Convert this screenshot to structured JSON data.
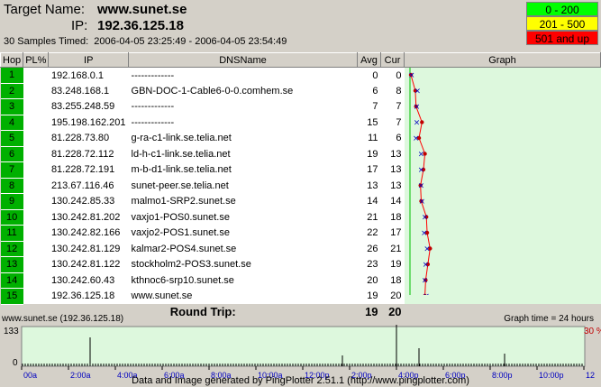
{
  "header": {
    "target_label": "Target Name:",
    "target_value": "www.sunet.se",
    "ip_label": "IP:",
    "ip_value": "192.36.125.18",
    "samples_text": "30 Samples Timed:",
    "samples_range": "2006-04-05 23:25:49 - 2006-04-05 23:54:49"
  },
  "legend": [
    {
      "label": "0 - 200",
      "color": "#00ff00"
    },
    {
      "label": "201 - 500",
      "color": "#ffff00"
    },
    {
      "label": "501 and up",
      "color": "#ff0000"
    }
  ],
  "columns": {
    "hop": "Hop",
    "pl": "PL%",
    "ip": "IP",
    "dns": "DNSName",
    "avg": "Avg",
    "cur": "Cur",
    "graph": "Graph"
  },
  "graph_scale": {
    "min": "0",
    "max": "230"
  },
  "hops": [
    {
      "hop": "1",
      "ip": "192.168.0.1",
      "dns": "-------------",
      "avg": "0",
      "cur": "0"
    },
    {
      "hop": "2",
      "ip": "83.248.168.1",
      "dns": "GBN-DOC-1-Cable6-0-0.comhem.se",
      "avg": "6",
      "cur": "8"
    },
    {
      "hop": "3",
      "ip": "83.255.248.59",
      "dns": "-------------",
      "avg": "7",
      "cur": "7"
    },
    {
      "hop": "4",
      "ip": "195.198.162.201",
      "dns": "-------------",
      "avg": "15",
      "cur": "7"
    },
    {
      "hop": "5",
      "ip": "81.228.73.80",
      "dns": "g-ra-c1-link.se.telia.net",
      "avg": "11",
      "cur": "6"
    },
    {
      "hop": "6",
      "ip": "81.228.72.112",
      "dns": "ld-h-c1-link.se.telia.net",
      "avg": "19",
      "cur": "13"
    },
    {
      "hop": "7",
      "ip": "81.228.72.191",
      "dns": "m-b-d1-link.se.telia.net",
      "avg": "17",
      "cur": "13"
    },
    {
      "hop": "8",
      "ip": "213.67.116.46",
      "dns": "sunet-peer.se.telia.net",
      "avg": "13",
      "cur": "13"
    },
    {
      "hop": "9",
      "ip": "130.242.85.33",
      "dns": "malmo1-SRP2.sunet.se",
      "avg": "14",
      "cur": "14"
    },
    {
      "hop": "10",
      "ip": "130.242.81.202",
      "dns": "vaxjo1-POS0.sunet.se",
      "avg": "21",
      "cur": "18"
    },
    {
      "hop": "11",
      "ip": "130.242.82.166",
      "dns": "vaxjo2-POS1.sunet.se",
      "avg": "22",
      "cur": "17"
    },
    {
      "hop": "12",
      "ip": "130.242.81.129",
      "dns": "kalmar2-POS4.sunet.se",
      "avg": "26",
      "cur": "21"
    },
    {
      "hop": "13",
      "ip": "130.242.81.122",
      "dns": "stockholm2-POS3.sunet.se",
      "avg": "23",
      "cur": "19"
    },
    {
      "hop": "14",
      "ip": "130.242.60.43",
      "dns": "kthnoc6-srp10.sunet.se",
      "avg": "20",
      "cur": "18"
    },
    {
      "hop": "15",
      "ip": "192.36.125.18",
      "dns": "www.sunet.se",
      "avg": "19",
      "cur": "20"
    }
  ],
  "round_trip": {
    "label": "Round Trip:",
    "avg": "19",
    "cur": "20"
  },
  "bottom_chart": {
    "title": "www.sunet.se (192.36.125.18)",
    "graph_time": "Graph time = 24 hours",
    "ymax": "133",
    "ymin": "0",
    "loss_label": "30 %",
    "x_ticks": [
      "00a",
      "2:00a",
      "4:00a",
      "6:00a",
      "8:00a",
      "10:00a",
      "12:00p",
      "2:00p",
      "4:00p",
      "6:00p",
      "8:00p",
      "10:00p",
      "12"
    ]
  },
  "footer": "Data and Image generated by PingPlotter 2.51.1 (http://www.pingplotter.com)"
}
